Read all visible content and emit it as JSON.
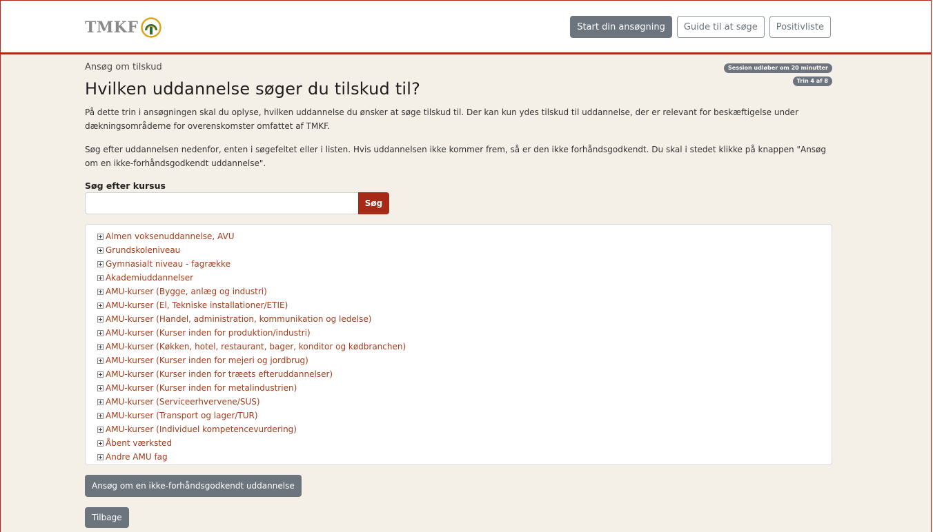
{
  "header": {
    "logo_text": "TMKF",
    "nav": {
      "start_label": "Start din ansøgning",
      "guide_label": "Guide til at søge",
      "positive_label": "Positivliste"
    }
  },
  "breadcrumb": "Ansøg om tilskud",
  "session_badge": "Session udløber om 20 minutter",
  "step_badge": "Trin 4 af 8",
  "title": "Hvilken uddannelse søger du tilskud til?",
  "intro_1": "På dette trin i ansøgningen skal du oplyse, hvilken uddannelse du ønsker at søge tilskud til. Der kan kun ydes tilskud til uddannelse, der er relevant for beskæftigelse under dækningsområderne for overenskomster omfattet af TMKF.",
  "intro_2": "Søg efter uddannelsen nedenfor, enten i søgefeltet eller i listen. Hvis uddannelsen ikke kommer frem, så er den ikke forhåndsgodkendt. Du skal i stedet klikke på knappen \"Ansøg om en ikke-forhåndsgodkendt uddannelse\".",
  "search": {
    "label": "Søg efter kursus",
    "value": "",
    "button_label": "Søg"
  },
  "tree": {
    "items": [
      {
        "label": "Almen voksenuddannelse, AVU"
      },
      {
        "label": "Grundskoleniveau"
      },
      {
        "label": "Gymnasialt niveau - fagrække"
      },
      {
        "label": "Akademiuddannelser"
      },
      {
        "label": "AMU-kurser (Bygge, anlæg og industri)"
      },
      {
        "label": "AMU-kurser (El, Tekniske installationer/ETIE)"
      },
      {
        "label": "AMU-kurser (Handel, administration, kommunikation og ledelse)"
      },
      {
        "label": "AMU-kurser (Kurser inden for produktion/industri)"
      },
      {
        "label": "AMU-kurser (Køkken, hotel, restaurant, bager, konditor og kødbranchen)"
      },
      {
        "label": "AMU-kurser (Kurser inden for mejeri og jordbrug)"
      },
      {
        "label": "AMU-kurser (Kurser inden for træets efteruddannelser)"
      },
      {
        "label": "AMU-kurser (Kurser inden for metalindustrien)"
      },
      {
        "label": "AMU-kurser (Serviceerhvervene/SUS)"
      },
      {
        "label": "AMU-kurser (Transport og lager/TUR)"
      },
      {
        "label": "AMU-kurser (Individuel kompetencevurdering)"
      },
      {
        "label": "Åbent værksted"
      },
      {
        "label": "Andre AMU fag"
      }
    ]
  },
  "apply_unapproved_label": "Ansøg om en ikke-forhåndsgodkendt uddannelse",
  "back_label": "Tilbage",
  "colors": {
    "brand_red": "#a62a16",
    "link": "#a43c1c",
    "gray_button": "#6c757d",
    "background": "#f4efe7"
  }
}
